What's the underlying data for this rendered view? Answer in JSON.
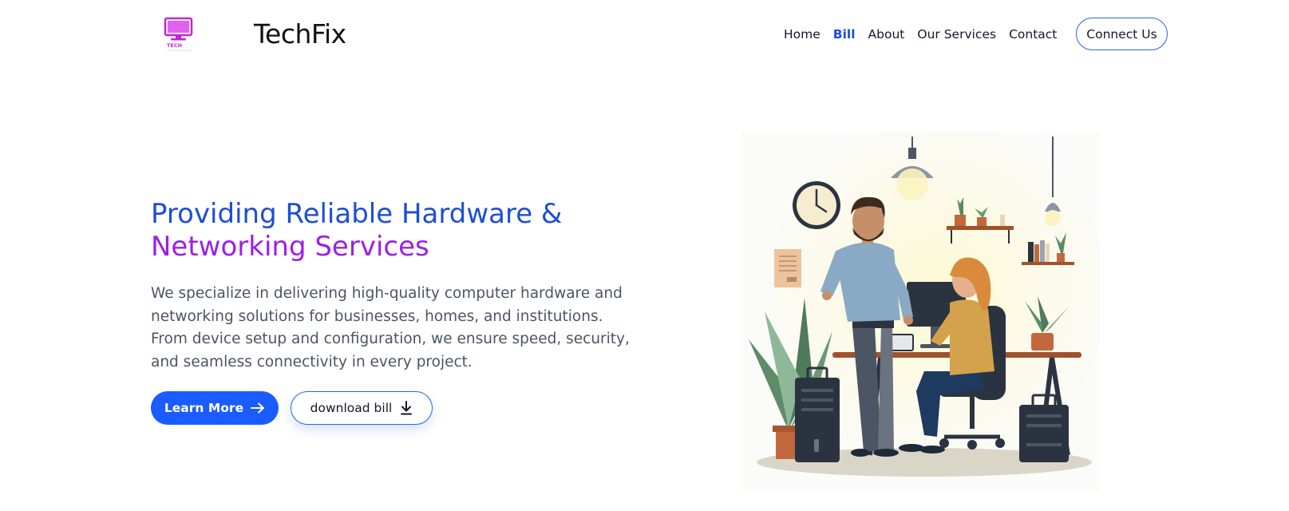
{
  "header": {
    "brand": "TechFix",
    "logo_text": "TECH",
    "nav": [
      {
        "label": "Home",
        "active": false
      },
      {
        "label": "Bill",
        "active": true
      },
      {
        "label": "About",
        "active": false
      },
      {
        "label": "Our Services",
        "active": false
      },
      {
        "label": "Contact",
        "active": false
      }
    ],
    "cta": "Connect Us"
  },
  "hero": {
    "title_line1": "Providing Reliable Hardware &",
    "title_line2": "Networking Services",
    "description": "We specialize in delivering high-quality computer hardware and networking solutions for businesses, homes, and institutions. From device setup and configuration, we ensure speed, security, and seamless connectivity in every project.",
    "primary_button": "Learn More",
    "secondary_button": "download bill"
  },
  "colors": {
    "accent": "#1a5cff",
    "title_blue": "#1d4ed8",
    "title_purple": "#9b1fe8",
    "logo_magenta": "#c026d3"
  },
  "icons": {
    "learn_more": "arrow-right-icon",
    "download": "download-icon",
    "logo": "monitor-icon"
  }
}
